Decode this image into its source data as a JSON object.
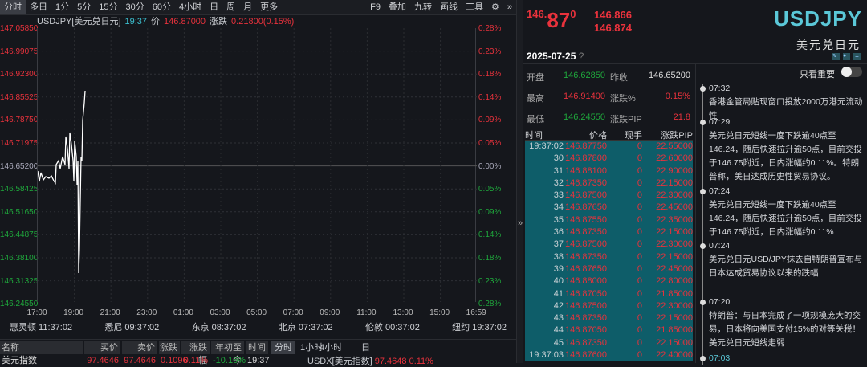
{
  "toolbar": {
    "tabs": [
      "分时",
      "多日",
      "1分",
      "5分",
      "15分",
      "30分",
      "60分",
      "4小时",
      "日",
      "周",
      "月",
      "更多"
    ],
    "right": [
      "F9",
      "叠加",
      "九转",
      "画线",
      "工具",
      "⚙",
      "»"
    ]
  },
  "info": {
    "symbol": "USDJPY[美元兑日元]",
    "time": "19:37",
    "price_label": "价",
    "price": "146.87000",
    "change_label": "涨跌",
    "change": "0.21800(0.15%)"
  },
  "yaxis": [
    "147.05850",
    "146.99075",
    "146.92300",
    "146.85525",
    "146.78750",
    "146.71975",
    "146.65200",
    "146.58425",
    "146.51650",
    "146.44875",
    "146.38100",
    "146.31325",
    "146.24550"
  ],
  "paxis": [
    "0.28%",
    "0.23%",
    "0.18%",
    "0.14%",
    "0.09%",
    "0.05%",
    "0.00%",
    "0.05%",
    "0.09%",
    "0.14%",
    "0.18%",
    "0.23%",
    "0.28%"
  ],
  "xaxis": [
    "17:00",
    "19:00",
    "21:00",
    "23:00",
    "01:00",
    "03:00",
    "05:00",
    "07:00",
    "09:00",
    "11:00",
    "13:00",
    "15:00",
    "16:59"
  ],
  "clocks": [
    "惠灵顿 11:37:02",
    "悉尼 09:37:02",
    "东京 08:37:02",
    "北京 07:37:02",
    "伦敦 00:37:02",
    "纽约 19:37:02"
  ],
  "bottom": {
    "headers": [
      "名称",
      "买价",
      "卖价",
      "涨跌",
      "涨跌幅",
      "年初至今",
      "时间"
    ],
    "row": [
      "美元指数",
      "97.4646",
      "97.4646",
      "0.1096",
      "0.11%",
      "-10.16%",
      "19:37"
    ],
    "tabs": [
      "分时",
      "1小时",
      "4小时",
      "日"
    ],
    "sub": {
      "symbol": "USDX[美元指数]",
      "price": "97.4648",
      "pct": "0.11%"
    }
  },
  "quote": {
    "big_prefix": "146.",
    "big_main": "87",
    "big_sup": "0",
    "bid": "146.866",
    "ask": "146.874",
    "symbol": "USDJPY",
    "name": "美元兑日元",
    "date": "2025-07-25",
    "help": "?"
  },
  "stats": [
    [
      "开盘",
      "146.62850",
      "昨收",
      "146.65200"
    ],
    [
      "最高",
      "146.91400",
      "涨跌%",
      "0.15%"
    ],
    [
      "最低",
      "146.24550",
      "涨跌PIP",
      "21.8"
    ]
  ],
  "trades": {
    "headers": [
      "时间",
      "价格",
      "现手",
      "涨跌PIP"
    ],
    "rows": [
      [
        "19:37:02",
        "146.87750",
        "0",
        "22.55000"
      ],
      [
        "30",
        "146.87800",
        "0",
        "22.60000"
      ],
      [
        "31",
        "146.88100",
        "0",
        "22.90000"
      ],
      [
        "32",
        "146.87350",
        "0",
        "22.15000"
      ],
      [
        "33",
        "146.87500",
        "0",
        "22.30000"
      ],
      [
        "34",
        "146.87650",
        "0",
        "22.45000"
      ],
      [
        "35",
        "146.87550",
        "0",
        "22.35000"
      ],
      [
        "36",
        "146.87350",
        "0",
        "22.15000"
      ],
      [
        "37",
        "146.87500",
        "0",
        "22.30000"
      ],
      [
        "38",
        "146.87350",
        "0",
        "22.15000"
      ],
      [
        "39",
        "146.87650",
        "0",
        "22.45000"
      ],
      [
        "40",
        "146.88000",
        "0",
        "22.80000"
      ],
      [
        "41",
        "146.87050",
        "0",
        "21.85000"
      ],
      [
        "42",
        "146.87500",
        "0",
        "22.30000"
      ],
      [
        "43",
        "146.87350",
        "0",
        "22.15000"
      ],
      [
        "44",
        "146.87050",
        "0",
        "21.85000"
      ],
      [
        "45",
        "146.87350",
        "0",
        "22.15000"
      ],
      [
        "19:37:03",
        "146.87600",
        "0",
        "22.40000"
      ]
    ]
  },
  "news": {
    "toggle_label": "只看重要",
    "items": [
      {
        "time": "07:32",
        "text": "香港金管局贴现窗口投放2000万港元流动性"
      },
      {
        "time": "07:29",
        "text": "美元兑日元短线一度下跌逾40点至146.24，随后快速拉升逾50点，目前交投于146.75附近，日内涨幅约0.11%。特朗普称，美日达成历史性贸易协议。"
      },
      {
        "time": "07:24",
        "text": "美元兑日元短线一度下跌逾40点至146.24，随后快速拉升逾50点，目前交投于146.75附近，日内涨幅约0.11%"
      },
      {
        "time": "07:24",
        "text": "美元兑日元USD/JPY抹去自特朗普宣布与日本达成贸易协议以来的跌幅"
      },
      {
        "time": "07:20",
        "text": "特朗普：与日本完成了一项规模庞大的交易，日本将向美国支付15%的对等关税！美元兑日元短线走弱"
      },
      {
        "time": "07:03",
        "text": ""
      }
    ]
  },
  "colors": {
    "up": "#e8323c",
    "down": "#1fa83c",
    "accent": "#5bc8d8",
    "table": "#0e5d69"
  }
}
